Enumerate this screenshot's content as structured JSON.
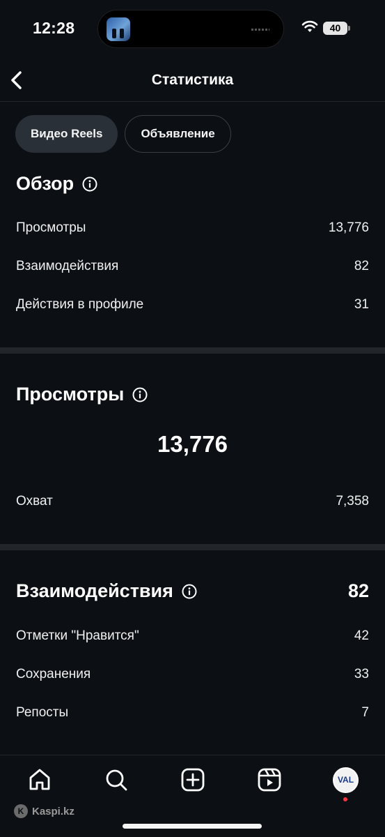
{
  "status_bar": {
    "time": "12:28",
    "battery": "40"
  },
  "header": {
    "title": "Статистика"
  },
  "tabs": [
    {
      "label": "Видео Reels",
      "active": true
    },
    {
      "label": "Объявление",
      "active": false
    }
  ],
  "overview": {
    "title": "Обзор",
    "rows": [
      {
        "label": "Просмотры",
        "value": "13,776"
      },
      {
        "label": "Взаимодействия",
        "value": "82"
      },
      {
        "label": "Действия в профиле",
        "value": "31"
      }
    ]
  },
  "views": {
    "title": "Просмотры",
    "total": "13,776",
    "rows": [
      {
        "label": "Охват",
        "value": "7,358"
      }
    ]
  },
  "interactions": {
    "title": "Взаимодействия",
    "total": "82",
    "rows": [
      {
        "label": "Отметки \"Нравится\"",
        "value": "42"
      },
      {
        "label": "Сохранения",
        "value": "33"
      },
      {
        "label": "Репосты",
        "value": "7"
      }
    ]
  },
  "bottom_nav": {
    "items": [
      "home-icon",
      "search-icon",
      "create-icon",
      "reels-icon",
      "profile-avatar"
    ],
    "avatar_text": "VAL"
  },
  "watermark": {
    "text": "Kaspi.kz"
  },
  "colors": {
    "background": "#0c1014",
    "divider": "#22262b",
    "active_tab": "#2a3038",
    "notification": "#ff3040"
  }
}
